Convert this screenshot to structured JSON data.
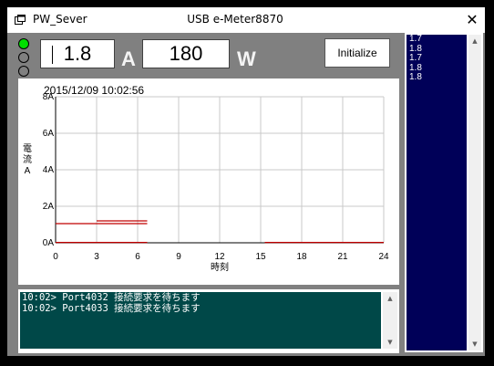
{
  "window": {
    "app_title": "PW_Sever",
    "device_title": "USB e-Meter8870",
    "close_glyph": "✕",
    "icon": "app-window-icon"
  },
  "status_leds": [
    {
      "name": "led-1",
      "color": "#00e000",
      "active": true
    },
    {
      "name": "led-2",
      "color": "#808080",
      "active": false
    },
    {
      "name": "led-3",
      "color": "#808080",
      "active": false
    }
  ],
  "readout": {
    "current_value": "1.8",
    "current_unit": "A",
    "power_value": "180",
    "power_unit": "W"
  },
  "toolbar": {
    "initialize_label": "Initialize"
  },
  "chart": {
    "timestamp": "2015/12/09 10:02:56",
    "ylabel_chars": [
      "電",
      "流",
      "A"
    ],
    "xlabel": "時刻"
  },
  "chart_data": {
    "type": "line",
    "xlabel": "時刻",
    "ylabel": "電流A",
    "xlim": [
      0,
      24
    ],
    "ylim": [
      0,
      8
    ],
    "x_ticks": [
      "0",
      "3",
      "6",
      "9",
      "12",
      "15",
      "18",
      "21",
      "24"
    ],
    "y_ticks": [
      "0A",
      "2A",
      "4A",
      "6A",
      "8A"
    ],
    "grid": true,
    "series": [
      {
        "color": "#c00000",
        "segments": [
          {
            "x": [
              0,
              6.7
            ],
            "y": [
              1.05,
              1.05
            ]
          },
          {
            "x": [
              3,
              6.7
            ],
            "y": [
              1.2,
              1.2
            ]
          },
          {
            "x": [
              0,
              6.7
            ],
            "y": [
              0.02,
              0.02
            ]
          },
          {
            "x": [
              15.3,
              24
            ],
            "y": [
              0.02,
              0.02
            ]
          }
        ]
      }
    ]
  },
  "log": {
    "lines": [
      "10:02> Port4032 接続要求を待ちます",
      "10:02> Port4033 接続要求を待ちます"
    ]
  },
  "readings": [
    "1.7",
    "1.8",
    "1.7",
    "1.8",
    "1.8"
  ],
  "colors": {
    "led_active": "#00e000",
    "log_bg": "#004848",
    "readings_bg": "#000058",
    "series_line": "#c00000"
  }
}
